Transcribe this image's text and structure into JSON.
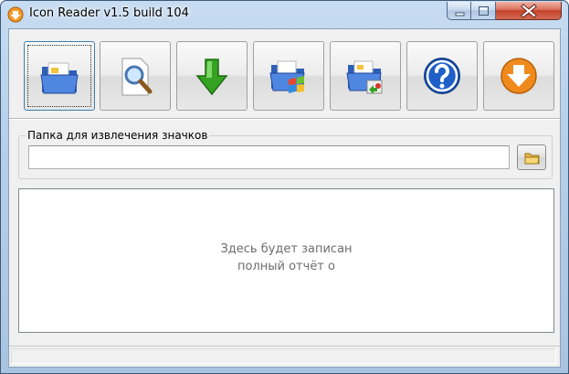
{
  "window": {
    "title": "Icon Reader v1.5 build 104",
    "app_icon": "orange-down-arrow-icon",
    "controls": [
      "minimize-icon",
      "maximize-icon",
      "close-icon"
    ]
  },
  "toolbar": {
    "buttons": [
      {
        "icon": "blue-folder-icon",
        "focused": true
      },
      {
        "icon": "magnifier-document-icon",
        "focused": false
      },
      {
        "icon": "green-down-arrow-icon",
        "focused": false
      },
      {
        "icon": "windows-folder-icon",
        "focused": false
      },
      {
        "icon": "folder-export-icon",
        "focused": false
      },
      {
        "icon": "help-icon",
        "focused": false
      },
      {
        "icon": "orange-download-icon",
        "focused": false
      }
    ]
  },
  "folder_group": {
    "label": "Папка для извлечения значков",
    "input_value": "",
    "browse_icon": "small-folder-icon"
  },
  "report": {
    "line1": "Здесь будет записан",
    "line2": "полный отчёт о"
  },
  "colors": {
    "title_gradient_top": "#c7dcf2",
    "close_red": "#c4412a",
    "folder_blue": "#3f6fc7",
    "arrow_green": "#35a321",
    "help_blue": "#1f5fc8",
    "orange": "#f08a1c"
  }
}
